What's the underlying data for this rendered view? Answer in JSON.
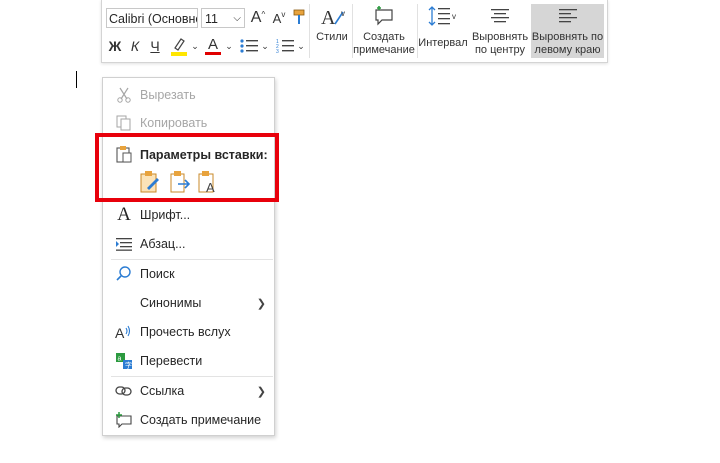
{
  "toolbar": {
    "font_name": "Calibri (Основне",
    "font_size": "11",
    "grow_font": "A",
    "shrink_font": "A",
    "bold": "Ж",
    "italic": "К",
    "underline": "Ч",
    "font_color_letter": "A",
    "highlight_color": "#ffe600",
    "font_color": "#e00000",
    "styles_label": "Стили",
    "comment_label_1": "Создать",
    "comment_label_2": "примечание",
    "spacing_label": "Интервал",
    "center_label_1": "Выровнять",
    "center_label_2": "по центру",
    "left_label_1": "Выровнять по",
    "left_label_2": "левому краю"
  },
  "menu": {
    "cut": "Вырезать",
    "copy": "Копировать",
    "paste_options": "Параметры вставки:",
    "font": "Шрифт...",
    "paragraph": "Абзац...",
    "search": "Поиск",
    "synonyms": "Синонимы",
    "read_aloud": "Прочесть вслух",
    "translate": "Перевести",
    "link": "Ссылка",
    "new_comment": "Создать примечание"
  },
  "colors": {
    "accent": "#2b7cd3",
    "highlight_frame": "#e8000b",
    "paste_orange": "#e8a33d"
  }
}
